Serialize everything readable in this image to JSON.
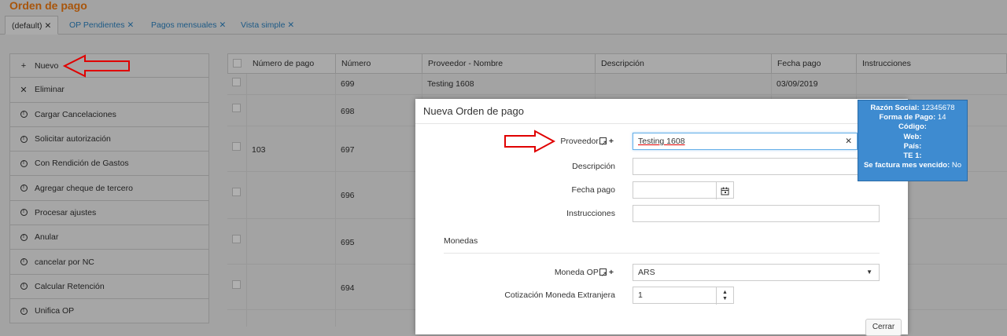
{
  "page": {
    "title": "Orden de pago"
  },
  "tabs": [
    {
      "label": "(default)",
      "active": true
    },
    {
      "label": "OP Pendientes"
    },
    {
      "label": "Pagos mensuales"
    },
    {
      "label": "Vista simple"
    }
  ],
  "sidebar": {
    "items": [
      {
        "label": "Nuevo",
        "icon": "plus-icon"
      },
      {
        "label": "Eliminar",
        "icon": "close-icon"
      },
      {
        "label": "Cargar Cancelaciones",
        "icon": "info-circle-icon"
      },
      {
        "label": "Solicitar autorización",
        "icon": "info-circle-icon"
      },
      {
        "label": "Con Rendición de Gastos",
        "icon": "info-circle-icon"
      },
      {
        "label": "Agregar cheque de tercero",
        "icon": "info-circle-icon"
      },
      {
        "label": "Procesar ajustes",
        "icon": "info-circle-icon"
      },
      {
        "label": "Anular",
        "icon": "info-circle-icon"
      },
      {
        "label": "cancelar por NC",
        "icon": "info-circle-icon"
      },
      {
        "label": "Calcular Retención",
        "icon": "info-circle-icon"
      },
      {
        "label": "Unifica OP",
        "icon": "info-circle-icon"
      }
    ]
  },
  "grid": {
    "columns": [
      "Número de pago",
      "Número",
      "Proveedor - Nombre",
      "Descripción",
      "Fecha pago",
      "Instrucciones"
    ],
    "rows": [
      {
        "numero_pago": "",
        "numero": "699",
        "proveedor": "Testing 1608",
        "descripcion": "",
        "fecha": "03/09/2019",
        "instrucciones": ""
      },
      {
        "numero_pago": "",
        "numero": "698",
        "proveedor": "",
        "descripcion": "",
        "fecha": "",
        "instrucciones": ""
      },
      {
        "numero_pago": "103",
        "numero": "697",
        "proveedor": "",
        "descripcion": "",
        "fecha": "",
        "instrucciones": ""
      },
      {
        "numero_pago": "",
        "numero": "696",
        "proveedor": "",
        "descripcion": "",
        "fecha": "",
        "instrucciones": ""
      },
      {
        "numero_pago": "",
        "numero": "695",
        "proveedor": "",
        "descripcion": "",
        "fecha": "",
        "instrucciones": ""
      },
      {
        "numero_pago": "",
        "numero": "694",
        "proveedor": "",
        "descripcion": "",
        "fecha": "",
        "instrucciones": ""
      }
    ]
  },
  "modal": {
    "title": "Nueva Orden de pago",
    "proveedor_label": "Proveedor",
    "proveedor_value": "Testing 1608",
    "descripcion_label": "Descripción",
    "descripcion_value": "",
    "fecha_label": "Fecha pago",
    "fecha_value": "",
    "instrucciones_label": "Instrucciones",
    "instrucciones_value": "",
    "section_monedas": "Monedas",
    "moneda_label": "Moneda OP",
    "moneda_value": "ARS",
    "cotizacion_label": "Cotización Moneda Extranjera",
    "cotizacion_value": "1",
    "close_label": "Cerrar"
  },
  "tooltip": {
    "lines": [
      {
        "k": "Razón Social:",
        "v": "12345678"
      },
      {
        "k": "Forma de Pago:",
        "v": "14"
      },
      {
        "k": "Código:",
        "v": ""
      },
      {
        "k": "Web:",
        "v": ""
      },
      {
        "k": "País:",
        "v": ""
      },
      {
        "k": "TE 1:",
        "v": ""
      },
      {
        "k": "Se factura mes vencido:",
        "v": "No"
      }
    ]
  },
  "colors": {
    "accent_title": "#a8550b",
    "tab_link": "#1d5a86",
    "tooltip_bg": "#3e8bd0",
    "annotation_red": "#e00000"
  }
}
